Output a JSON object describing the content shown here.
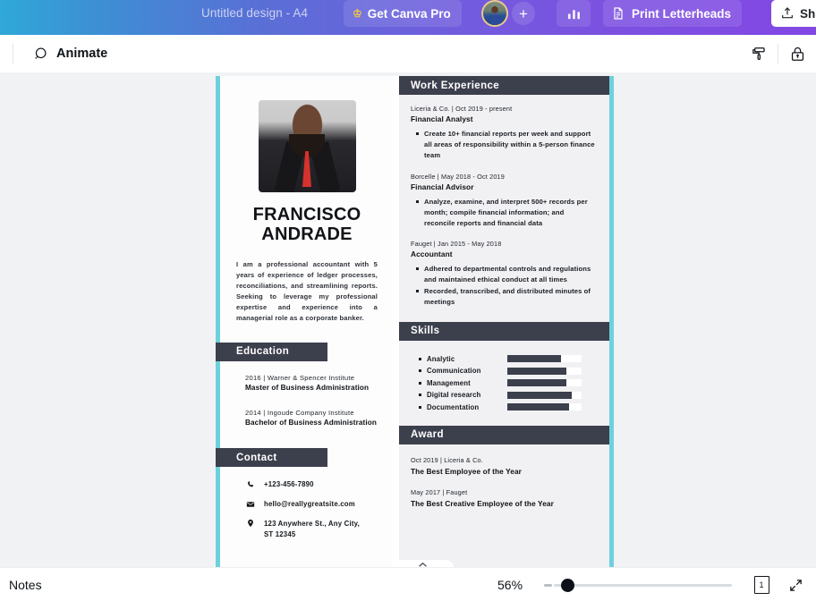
{
  "topbar": {
    "doc_title": "Untitled design - A4",
    "canva_pro_label": "Get Canva Pro",
    "crown_icon": "crown-icon",
    "avatar_icon": "user-avatar",
    "plus_label": "+",
    "chart_icon": "bar-chart-icon",
    "print_label": "Print Letterheads",
    "print_icon": "document-icon",
    "share_label": "Sh",
    "share_icon": "share-upload-icon"
  },
  "toolbar": {
    "animate_label": "Animate",
    "animate_icon": "animate-circles-icon",
    "paint_roller_icon": "paint-roller-icon",
    "lock_icon": "lock-icon"
  },
  "resume": {
    "name_line1": "FRANCISCO",
    "name_line2": "ANDRADE",
    "bio": "I am a professional accountant with 5 years of experience of ledger processes, reconciliations, and streamlining reports. Seeking to leverage my professional expertise and experience into a managerial role as a corporate banker.",
    "education_heading": "Education",
    "education": [
      {
        "meta": "2016 | Warner & Spencer Institute",
        "degree": "Master of Business Administration"
      },
      {
        "meta": "2014 | Ingoude Company Institute",
        "degree": "Bachelor of  Business Administration"
      }
    ],
    "contact_heading": "Contact",
    "contact": [
      {
        "icon": "phone-icon",
        "text": "+123-456-7890"
      },
      {
        "icon": "email-icon",
        "text": "hello@reallygreatsite.com"
      },
      {
        "icon": "location-pin-icon",
        "text": "123 Anywhere St., Any City, ST 12345"
      }
    ],
    "work_heading": "Work Experience",
    "jobs": [
      {
        "meta": "Liceria & Co. | Oct 2019 - present",
        "title": "Financial Analyst",
        "bullets": [
          "Create 10+ financial reports per week and support all areas of responsibility within a 5-person finance team"
        ]
      },
      {
        "meta": "Borcelle | May 2018 - Oct 2019",
        "title": "Financial Advisor",
        "bullets": [
          "Analyze, examine, and interpret 500+ records per month; compile financial information; and reconcile reports and financial data"
        ]
      },
      {
        "meta": "Fauget | Jan 2015 - May 2018",
        "title": "Accountant",
        "bullets": [
          "Adhered to departmental controls and regulations and maintained ethical conduct at all times",
          "Recorded, transcribed, and distributed minutes of meetings"
        ]
      }
    ],
    "skills_heading": "Skills",
    "skills": [
      {
        "name": "Analytic",
        "level": 72
      },
      {
        "name": "Communication",
        "level": 80
      },
      {
        "name": "Management",
        "level": 80
      },
      {
        "name": "Digital research",
        "level": 87
      },
      {
        "name": "Documentation",
        "level": 83
      }
    ],
    "award_heading": "Award",
    "awards": [
      {
        "meta": "Oct 2019 | Liceria & Co.",
        "title": "The Best Employee of the Year"
      },
      {
        "meta": "May 2017 | Fauget",
        "title": "The Best Creative Employee of the Year"
      }
    ]
  },
  "bottombar": {
    "notes_label": "Notes",
    "zoom_value": "56%",
    "page_number": "1",
    "fullscreen_icon": "expand-icon",
    "collapse_icon": "chevron-up-icon"
  },
  "colors": {
    "accent_teal": "#6fd0dd",
    "section_dark": "#3c3f4c",
    "brand_purple": "#7b52e0"
  }
}
